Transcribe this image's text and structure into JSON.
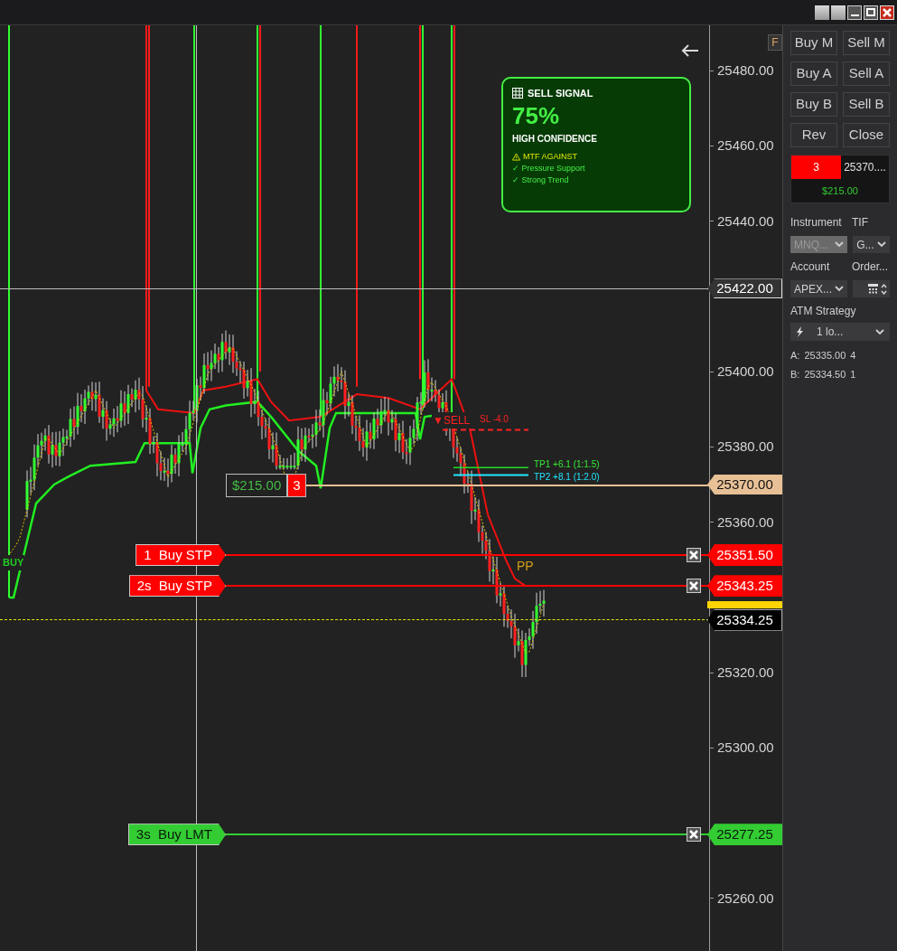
{
  "toolbar": {
    "window_buttons": [
      {
        "kind": "blank"
      },
      {
        "kind": "blank"
      },
      {
        "kind": "minimize"
      },
      {
        "kind": "maximize"
      },
      {
        "kind": "close"
      }
    ]
  },
  "chart": {
    "corner_button": "F",
    "price_axis": [
      "25480.00",
      "25460.00",
      "25440.00",
      "25400.00",
      "25380.00",
      "25360.00",
      "25320.00",
      "25300.00",
      "25260.00"
    ],
    "crosshair_price": "25422.00",
    "signal": {
      "title": "SELL SIGNAL",
      "percent": "75%",
      "confidence": "HIGH CONFIDENCE",
      "items": [
        {
          "kind": "warning",
          "text": "MTF AGAINST"
        },
        {
          "kind": "check",
          "text": "✓ Pressure Support"
        },
        {
          "kind": "check",
          "text": "✓ Strong Trend"
        }
      ]
    },
    "markers": [
      {
        "kind": "buy",
        "text": "BUY"
      },
      {
        "kind": "sell",
        "text": "▼SELL"
      },
      {
        "kind": "stop",
        "text": "SL -4.0"
      },
      {
        "kind": "tp1",
        "text": "TP1 +6.1 (1:1.5)"
      },
      {
        "kind": "tp2",
        "text": "TP2 +8.1 (1:2.0)"
      },
      {
        "kind": "pivot",
        "text": "PP"
      }
    ],
    "position": {
      "pnl": "$215.00",
      "quantity": "3",
      "price": "25370.00"
    },
    "orders": [
      {
        "label": "1  Buy STP",
        "price": "25351.50",
        "kind": "stop"
      },
      {
        "label": "2s  Buy STP",
        "price": "25343.25",
        "kind": "stop"
      },
      {
        "label": "3s  Buy LMT",
        "price": "25277.25",
        "kind": "limit"
      }
    ],
    "last_price": "25334.25"
  },
  "panel": {
    "buttons": [
      "Buy M",
      "Sell M",
      "Buy A",
      "Sell A",
      "Buy B",
      "Sell B",
      "Rev",
      "Close"
    ],
    "position_quantity": "3",
    "position_price": "25370....",
    "position_pnl": "$215.00",
    "instrument_label": "Instrument",
    "tif_label": "TIF",
    "instrument": {
      "value": "MNQ...",
      "disabled": true
    },
    "tif": {
      "value": "G...",
      "disabled": false
    },
    "account_label": "Account",
    "order_label": "Order...",
    "account": {
      "value": "APEX...",
      "disabled": false
    },
    "atm_label": "ATM Strategy",
    "atm": "1 lo...",
    "quotes": [
      {
        "side": "A:",
        "price": "25335.00",
        "size": "4"
      },
      {
        "side": "B:",
        "price": "25334.50",
        "size": "1"
      }
    ]
  }
}
